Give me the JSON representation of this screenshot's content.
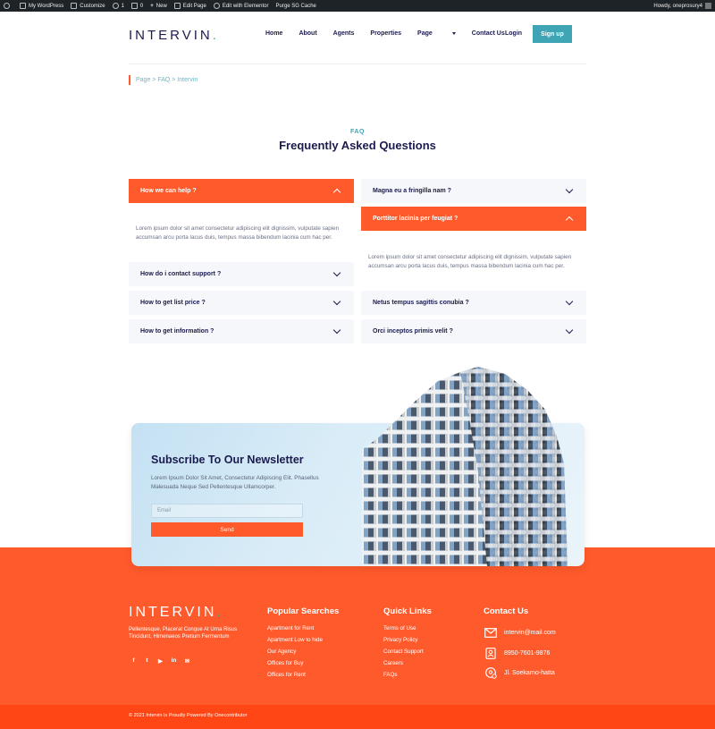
{
  "admin_bar": {
    "my_wordpress": "My WordPress",
    "customize": "Customize",
    "updates_count": "1",
    "comments_count": "0",
    "new": "New",
    "edit_page": "Edit Page",
    "edit_elementor": "Edit with Elementor",
    "purge": "Purge SG Cache",
    "howdy": "Howdy, oneprosury4"
  },
  "header": {
    "logo": "INTERVIN",
    "logo_dot": ".",
    "nav": [
      "Home",
      "About",
      "Agents",
      "Properties",
      "Page",
      "Contact Us"
    ],
    "login": "Login",
    "signup": "Sign up"
  },
  "breadcrumb": "Page > FAQ > Intervin",
  "faq": {
    "tag": "FAQ",
    "title": "Frequently Asked Questions",
    "left": [
      {
        "q": "How we can help ?",
        "open": true
      },
      {
        "q": "How do i contact support ?",
        "open": false
      },
      {
        "q": "How to get list price ?",
        "open": false
      },
      {
        "q": "How to get information ?",
        "open": false
      }
    ],
    "right": [
      {
        "q": "Magna eu a fringilla nam ?",
        "open": false
      },
      {
        "q": "Porttitor lacinia per feugiat ?",
        "open": true
      },
      {
        "q": "Netus tempus sagittis conubia ?",
        "open": false
      },
      {
        "q": "Orci inceptos primis velit ?",
        "open": false
      }
    ],
    "answer_left": "Lorem ipsum dolor sit amet consectetur adipiscing elit dignissim, vulputate sapien accumsan arcu porta lacus duis, tempus massa bibendum lacinia cum hac per.",
    "answer_right": "Lorem ipsum dolor sit amet consectetur adipiscing elit dignissim, vulputate sapien accumsan arcu porta lacus duis, tempus massa bibendum lacinia cum hac per."
  },
  "newsletter": {
    "title": "Subscribe To Our Newsletter",
    "text": "Lorem Ipsum Dolor Sit Amet, Consectetur Adipiscing Elit. Phasellus Malesuada Neque Sed Pellentesque Ullamcorper.",
    "email_placeholder": "Email",
    "send": "Send"
  },
  "footer": {
    "logo": "INTERVIN",
    "logo_dot": ".",
    "description": "Pellentesque, Placerat Congue At Urna Risus Tincidunt, Himenaeos Pretium Fermentum",
    "social_icons": [
      "facebook-icon",
      "twitter-icon",
      "youtube-icon",
      "linkedin-icon",
      "mail-icon"
    ],
    "popular_title": "Popular Searches",
    "popular": [
      "Apartment for Rent",
      "Apartment Low to hide",
      "Our Agency",
      "Offices for Buy",
      "Offices for Rent"
    ],
    "quick_title": "Quick Links",
    "quick": [
      "Terms of Use",
      "Privacy Policy",
      "Contact Support",
      "Careers",
      "FAQs"
    ],
    "contact_title": "Contact Us",
    "email": "intervin@mail.com",
    "phone": "8950-7601-9876",
    "address": "Jl. Soekarno-hatta",
    "copyright": "© 2021 Intervin Is Proudly Powered By Onecontributor"
  },
  "colors": {
    "accent": "#ff5a2c",
    "teal": "#3fa5b4",
    "navy": "#1b1b4f"
  }
}
